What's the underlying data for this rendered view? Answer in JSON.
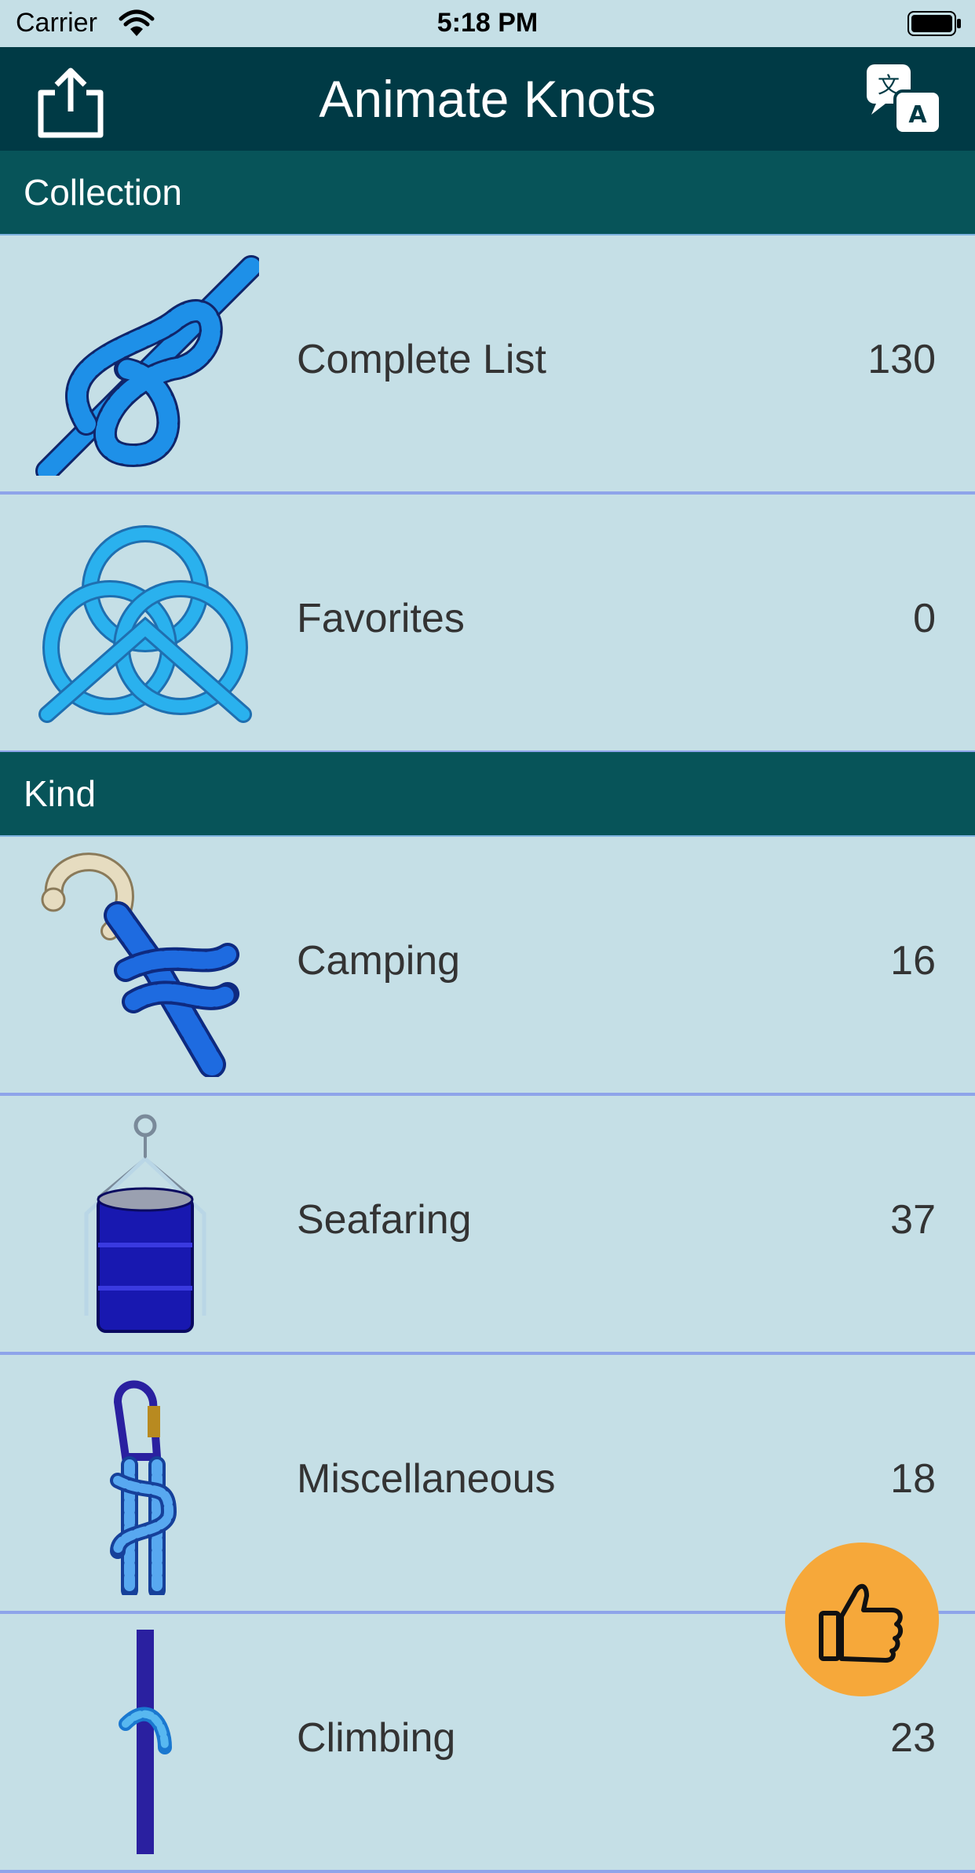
{
  "status_bar": {
    "carrier": "Carrier",
    "time": "5:18 PM"
  },
  "navbar": {
    "title": "Animate Knots"
  },
  "sections": [
    {
      "title": "Collection",
      "rows": [
        {
          "label": "Complete List",
          "count": "130"
        },
        {
          "label": "Favorites",
          "count": "0"
        }
      ]
    },
    {
      "title": "Kind",
      "rows": [
        {
          "label": "Camping",
          "count": "16"
        },
        {
          "label": "Seafaring",
          "count": "37"
        },
        {
          "label": "Miscellaneous",
          "count": "18"
        },
        {
          "label": "Climbing",
          "count": "23"
        }
      ]
    }
  ],
  "colors": {
    "navbar": "#003a45",
    "section": "#075459",
    "row": "#c5dfe6",
    "divider": "#8ea4ea",
    "like_button": "#f6a83a"
  }
}
